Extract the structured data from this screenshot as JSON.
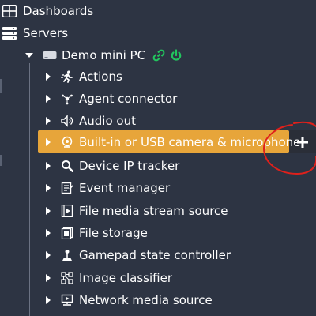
{
  "tree": {
    "dashboards_label": "Dashboards",
    "servers_label": "Servers",
    "server": {
      "name": "Demo mini PC",
      "status_color": "#22c55e"
    },
    "items": [
      {
        "label": "Actions",
        "icon": "running-person-icon"
      },
      {
        "label": "Agent connector",
        "icon": "agent-network-icon"
      },
      {
        "label": "Audio out",
        "icon": "speaker-icon"
      },
      {
        "label": "Built-in or USB camera & microphone",
        "icon": "webcam-icon",
        "selected": true
      },
      {
        "label": "Device IP tracker",
        "icon": "magnifier-icon"
      },
      {
        "label": "Event manager",
        "icon": "event-manager-icon"
      },
      {
        "label": "File media stream source",
        "icon": "file-media-icon"
      },
      {
        "label": "File storage",
        "icon": "file-storage-icon"
      },
      {
        "label": "Gamepad state controller",
        "icon": "joystick-icon"
      },
      {
        "label": "Image classifier",
        "icon": "image-classifier-icon"
      },
      {
        "label": "Network media source",
        "icon": "network-media-icon"
      }
    ]
  },
  "colors": {
    "background": "#2d3443",
    "selected_bg": "#e7a53a",
    "annotation": "#e0201b",
    "link_green": "#22c55e"
  }
}
